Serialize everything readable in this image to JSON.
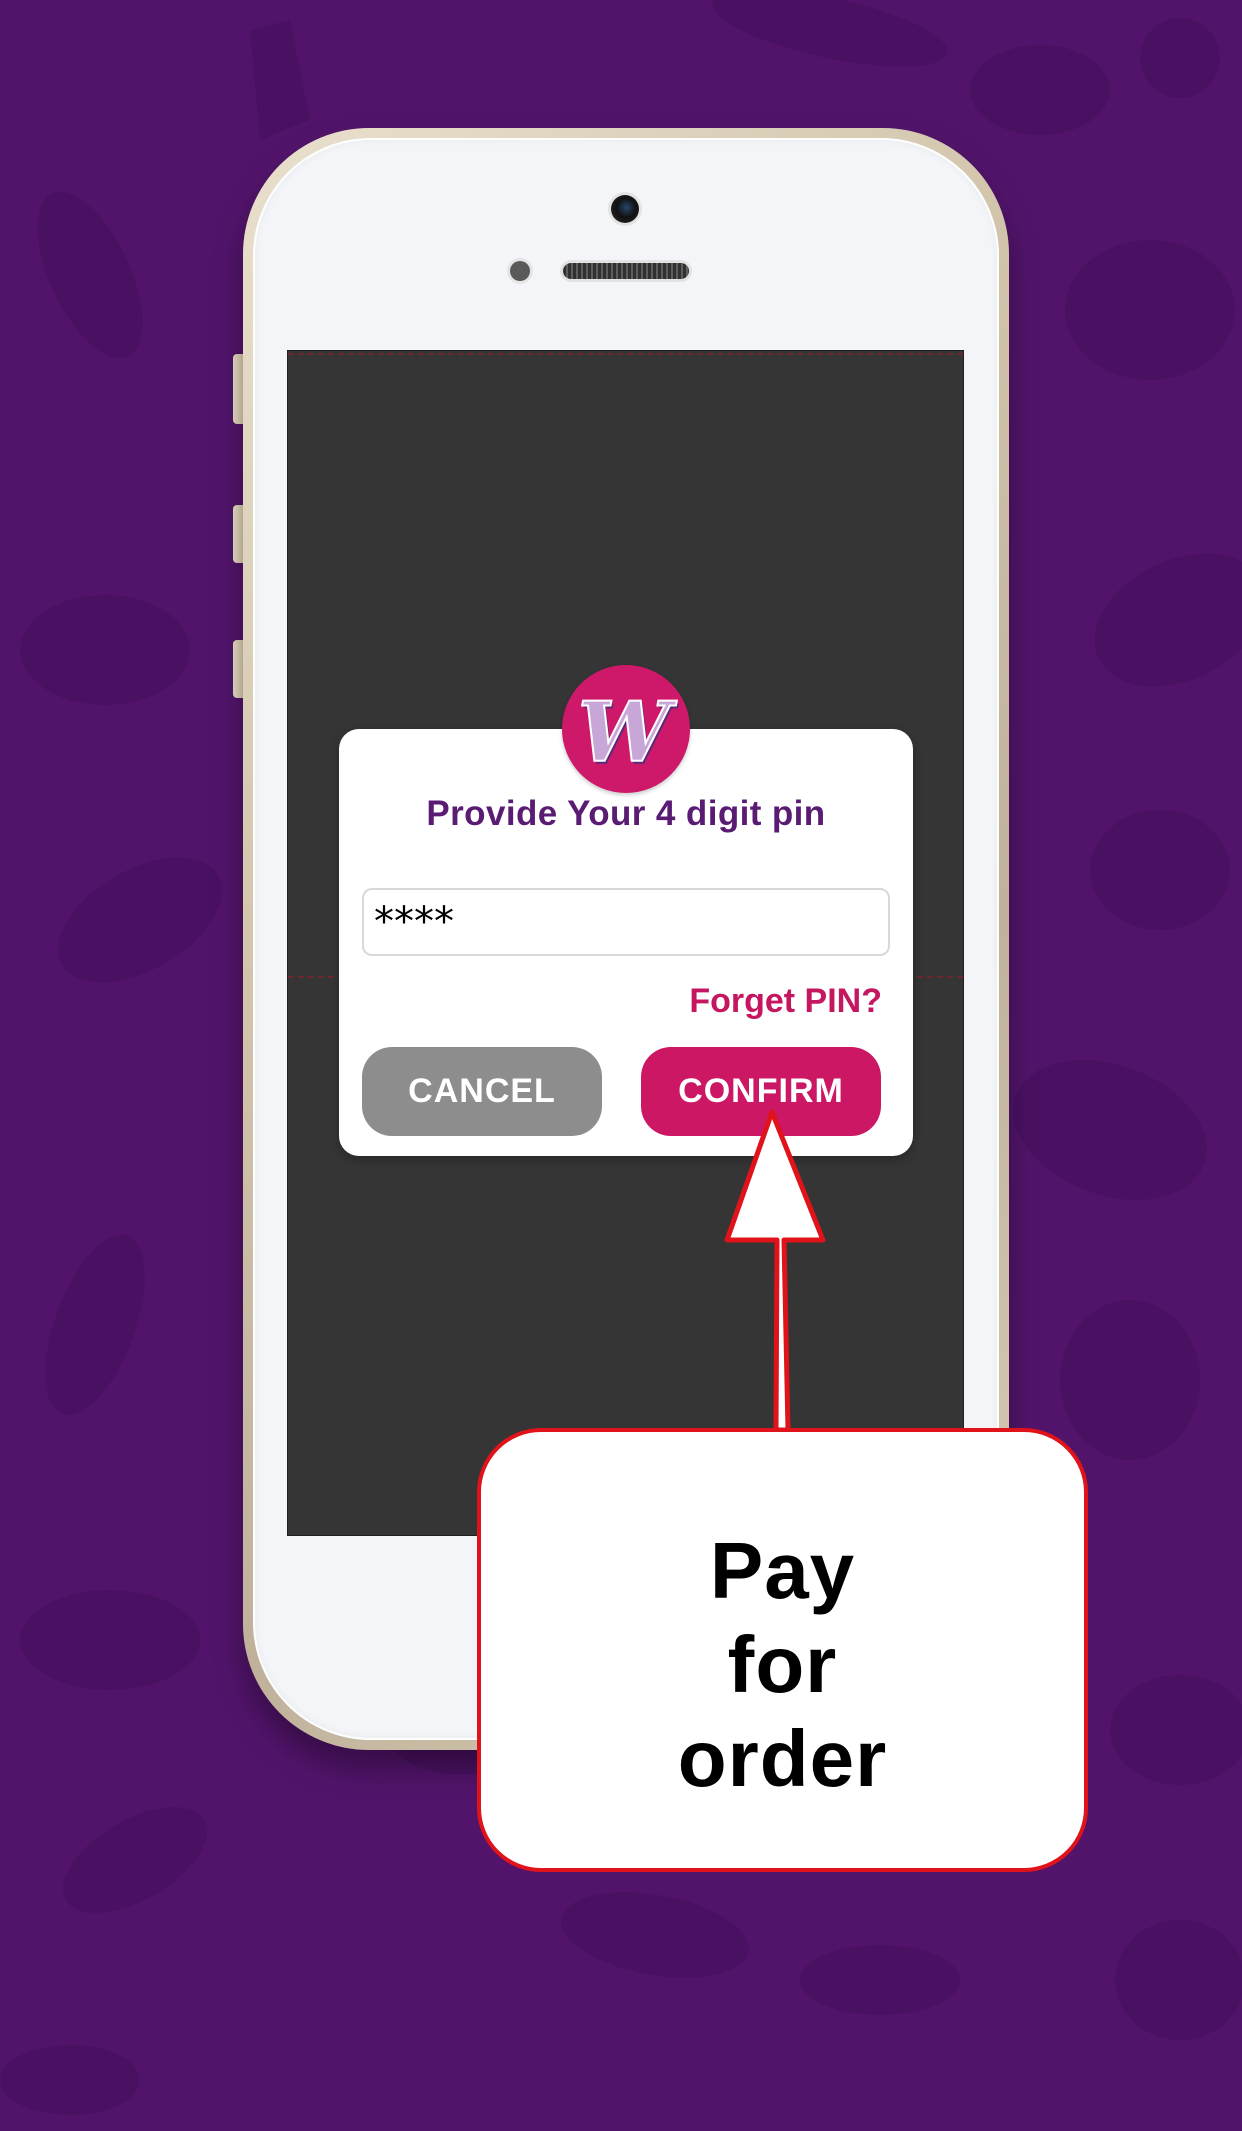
{
  "colors": {
    "background": "#52146b",
    "brand_purple": "#5a1b73",
    "brand_pink": "#cc1765",
    "cancel_gray": "#8d8d8d",
    "callout_border": "#e0121a",
    "screen_dark": "#353535"
  },
  "icons": {
    "logo": "w-logo-icon",
    "background_pattern": "food-pattern-icons",
    "pointer": "arrow-up-icon"
  },
  "dialog": {
    "logo_letter": "W",
    "title": "Provide Your 4 digit pin",
    "pin_value": "****",
    "forgot_link": "Forget PIN?",
    "cancel_label": "CANCEL",
    "confirm_label": "CONFIRM"
  },
  "callout": {
    "lines": [
      "Pay",
      "for",
      "order"
    ]
  }
}
